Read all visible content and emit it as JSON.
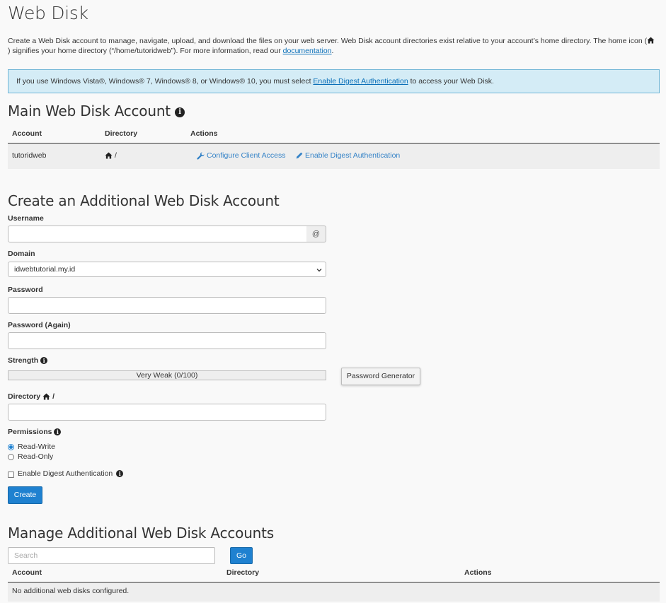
{
  "page": {
    "title": "Web Disk",
    "description_part1": "Create a Web Disk account to manage, navigate, upload, and download the files on your web server. Web Disk account directories exist relative to your account’s home directory. The home icon (",
    "description_part2": ") signifies your home directory (“/home/tutoridweb”). For more information, read our",
    "documentation_link": "documentation",
    "description_end": "."
  },
  "alert": {
    "text_before": "If you use Windows Vista®, Windows® 7, Windows® 8, or Windows® 10, you must select",
    "link": "Enable Digest Authentication",
    "text_after": "to access your Web Disk."
  },
  "main_account": {
    "heading": "Main Web Disk Account",
    "columns": [
      "Account",
      "Directory",
      "Actions"
    ],
    "row": {
      "account": "tutoridweb",
      "directory": "/",
      "actions": [
        "Configure Client Access",
        "Enable Digest Authentication"
      ]
    }
  },
  "create_form": {
    "heading": "Create an Additional Web Disk Account",
    "username_label": "Username",
    "username_value": "",
    "username_addon": "@",
    "domain_label": "Domain",
    "domain_value": "idwebtutorial.my.id",
    "password_label": "Password",
    "password_again_label": "Password (Again)",
    "strength_label": "Strength",
    "strength_text": "Very Weak (0/100)",
    "strength_value": 0,
    "password_generator_label": "Password Generator",
    "directory_label": "Directory",
    "directory_suffix": "/",
    "directory_value": "",
    "permissions_label": "Permissions",
    "permission_options": [
      "Read-Write",
      "Read-Only"
    ],
    "permission_selected": "Read-Write",
    "digest_label": "Enable Digest Authentication",
    "digest_checked": false,
    "create_button": "Create"
  },
  "manage": {
    "heading": "Manage Additional Web Disk Accounts",
    "search_placeholder": "Search",
    "go_button": "Go",
    "columns": [
      "Account",
      "Directory",
      "Actions"
    ],
    "empty_message": "No additional web disks configured."
  },
  "colors": {
    "link": "#0a6fb8",
    "primary_button": "#1f81d0",
    "alert_bg": "#d4ecf6",
    "alert_border": "#6fb5d6"
  },
  "icons": [
    "home-icon",
    "info-icon",
    "wrench-icon",
    "pencil-icon",
    "chevron-down-icon"
  ]
}
